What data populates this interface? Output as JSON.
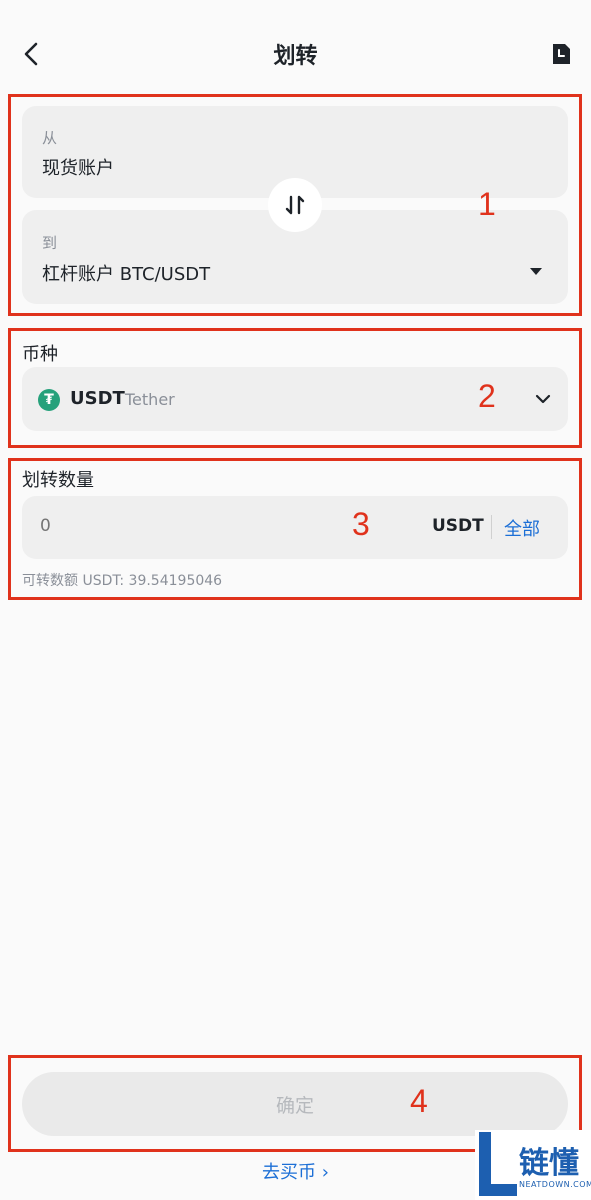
{
  "header": {
    "title": "划转"
  },
  "transfer": {
    "from_label": "从",
    "from_value": "现货账户",
    "to_label": "到",
    "to_value": "杠杆账户 BTC/USDT"
  },
  "coin": {
    "section_label": "币种",
    "symbol": "USDT",
    "name": "Tether",
    "icon_glyph": "₮",
    "icon_color": "#26a17b"
  },
  "amount": {
    "section_label": "划转数量",
    "placeholder": "0",
    "unit": "USDT",
    "all_label": "全部",
    "available_text": "可转数额 USDT: 39.54195046"
  },
  "confirm_label": "确定",
  "buy_link": "去买币 ›",
  "annotations": [
    "1",
    "2",
    "3",
    "4"
  ],
  "watermark": {
    "text": "链懂",
    "sub": "NEATDOWN.COM"
  },
  "colors": {
    "accent": "#1c6fd6",
    "annotation": "#e0321c",
    "card": "#efefef"
  }
}
